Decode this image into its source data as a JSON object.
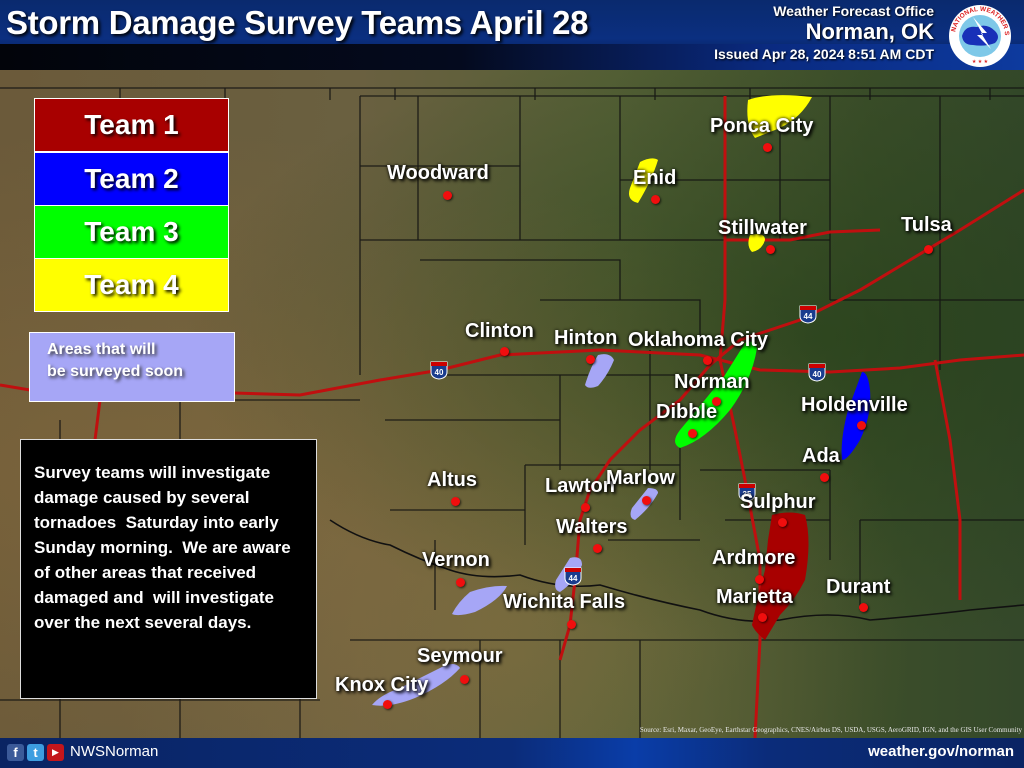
{
  "header": {
    "title": "Storm Damage Survey Teams April 28",
    "office_label": "Weather Forecast Office",
    "office_location": "Norman, OK",
    "issued": "Issued Apr 28, 2024 8:51 AM CDT",
    "logo": {
      "icon": "nws-logo-icon",
      "ring_text": "NATIONAL WEATHER SERVICE"
    }
  },
  "legend": {
    "teams": [
      {
        "label": "Team 1",
        "color": "#a80000"
      },
      {
        "label": "Team 2",
        "color": "#0000ff"
      },
      {
        "label": "Team 3",
        "color": "#00ff00"
      },
      {
        "label": "Team 4",
        "color": "#ffff00"
      }
    ],
    "soon": {
      "label_line1": "Areas that will",
      "label_line2": "be surveyed soon",
      "color": "#a6a6f6"
    }
  },
  "note": {
    "text": "Survey teams will investigate damage caused by several tornadoes  Saturday into early Sunday morning.  We are aware of other areas that received damaged and  will investigate over the next several days."
  },
  "map": {
    "cities": [
      "Woodward",
      "Enid",
      "Ponca City",
      "Stillwater",
      "Tulsa",
      "Clinton",
      "Hinton",
      "Oklahoma City",
      "Norman",
      "Dibble",
      "Holdenville",
      "Ada",
      "Altus",
      "Lawton",
      "Marlow",
      "Walters",
      "Sulphur",
      "Vernon",
      "Ardmore",
      "Wichita Falls",
      "Marietta",
      "Durant",
      "Seymour",
      "Knox City"
    ],
    "interstates": [
      "40",
      "40",
      "44",
      "44",
      "35",
      "44"
    ],
    "survey_areas": [
      {
        "team": "Team 4",
        "near": "Ponca City"
      },
      {
        "team": "Team 4",
        "near": "Enid"
      },
      {
        "team": "Team 4",
        "near": "Stillwater"
      },
      {
        "team": "Team 3",
        "near": "Oklahoma City / Norman / Dibble"
      },
      {
        "team": "Team 2",
        "near": "Holdenville"
      },
      {
        "team": "Team 1",
        "near": "Sulphur / Ardmore / Marietta"
      },
      {
        "team": "Soon",
        "near": "Hinton"
      },
      {
        "team": "Soon",
        "near": "Marlow"
      },
      {
        "team": "Soon",
        "near": "Wichita Falls"
      },
      {
        "team": "Soon",
        "near": "Vernon"
      },
      {
        "team": "Soon",
        "near": "Knox City / Seymour"
      }
    ],
    "attribution": "Source: Esri, Maxar, GeoEye, Earthstar Geographics, CNES/Airbus DS, USDA, USGS, AeroGRID, IGN, and the GIS User Community"
  },
  "footer": {
    "social": [
      {
        "icon": "facebook-icon",
        "glyph": "f"
      },
      {
        "icon": "twitter-icon",
        "glyph": "t"
      },
      {
        "icon": "youtube-icon",
        "glyph": "▶"
      }
    ],
    "handle": "NWSNorman",
    "website": "weather.gov/norman"
  }
}
